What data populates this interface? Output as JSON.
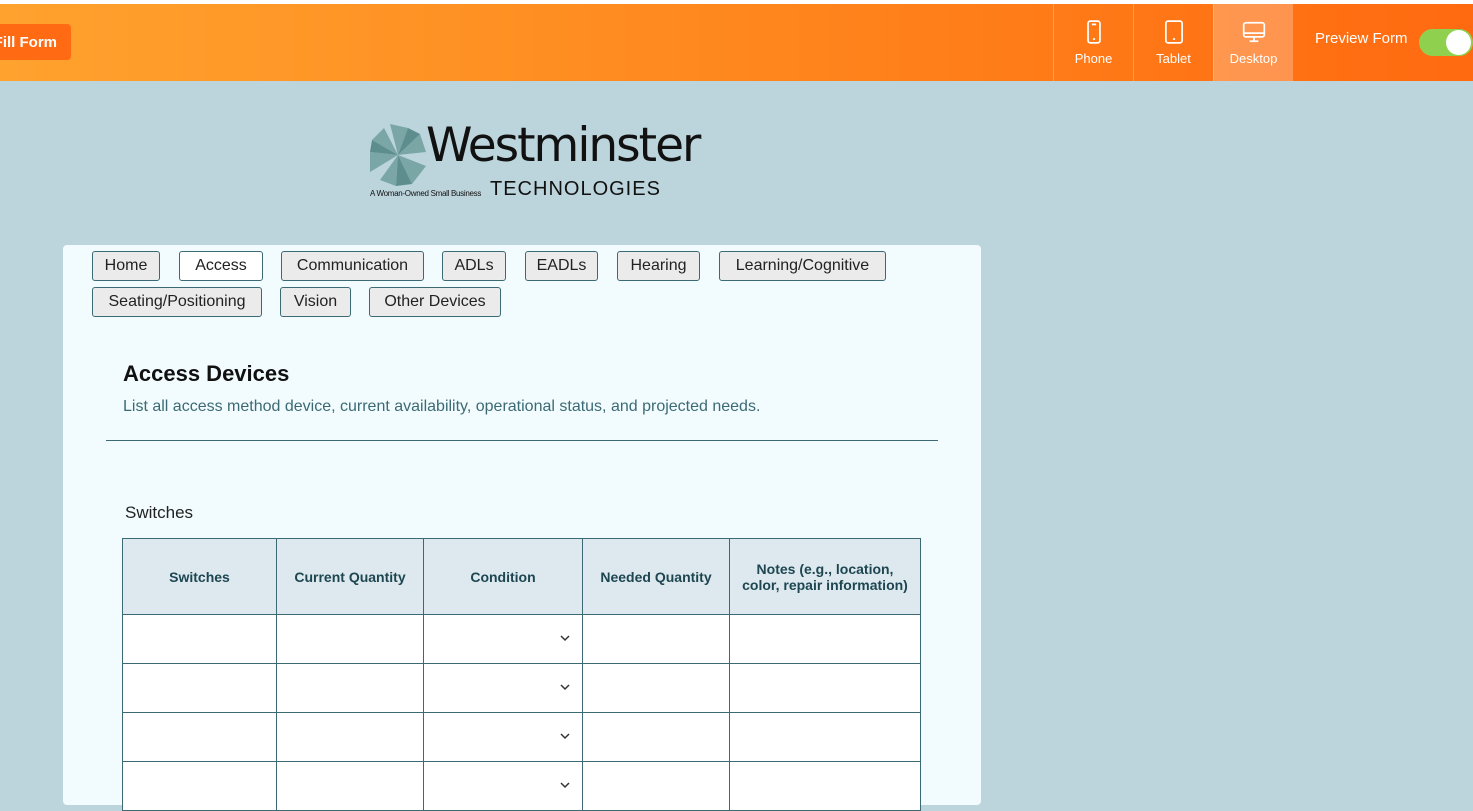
{
  "toolbar": {
    "fill_form": "Fill Form",
    "devices": [
      {
        "label": "Phone",
        "icon": "phone-icon"
      },
      {
        "label": "Tablet",
        "icon": "tablet-icon"
      },
      {
        "label": "Desktop",
        "icon": "desktop-icon",
        "active": true
      }
    ],
    "preview_label": "Preview Form",
    "preview_enabled": true
  },
  "logo": {
    "name": "Westminster",
    "subtitle": "TECHNOLOGIES",
    "tagline": "A Woman-Owned Small Business"
  },
  "tabs": [
    {
      "label": "Home"
    },
    {
      "label": "Access",
      "active": true
    },
    {
      "label": "Communication"
    },
    {
      "label": "ADLs"
    },
    {
      "label": "EADLs"
    },
    {
      "label": "Hearing"
    },
    {
      "label": "Learning/Cognitive"
    },
    {
      "label": "Seating/Positioning"
    },
    {
      "label": "Vision"
    },
    {
      "label": "Other Devices"
    }
  ],
  "section": {
    "title": "Access Devices",
    "description": "List all access method device, current availability, operational status, and projected needs."
  },
  "table": {
    "label": "Switches",
    "columns": [
      "Switches",
      "Current Quantity",
      "Condition",
      "Needed Quantity",
      "Notes (e.g., location, color, repair information)"
    ],
    "rows": [
      [
        "",
        "",
        "",
        "",
        ""
      ],
      [
        "",
        "",
        "",
        "",
        ""
      ],
      [
        "",
        "",
        "",
        "",
        ""
      ],
      [
        "",
        "",
        "",
        "",
        ""
      ]
    ]
  },
  "colors": {
    "accent": "#ff7a1a",
    "background": "#bcd4dc",
    "border": "#3c6a74"
  }
}
